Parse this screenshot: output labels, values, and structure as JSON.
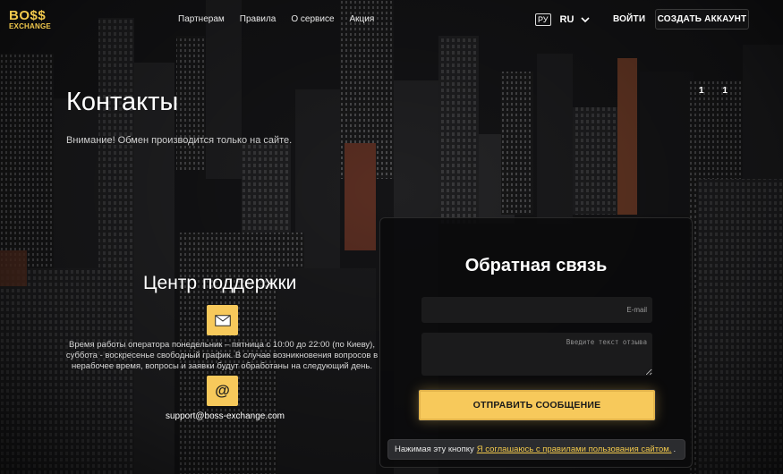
{
  "header": {
    "logo_line1": "BO$$",
    "logo_line2": "EXCHANGE",
    "nav": [
      "Партнерам",
      "Правила",
      "О сервисе",
      "Акция"
    ],
    "lang_flag": "РУ",
    "lang_code": "RU",
    "login": "ВОЙТИ",
    "signup": "СОЗДАТЬ АККАУНТ"
  },
  "page": {
    "title": "Контакты",
    "notice": "Внимание! Обмен производится только на сайте.",
    "corner_numbers": "1 1"
  },
  "support": {
    "title": "Центр поддержки",
    "hours": "Время работы оператора понедельник – пятница с 10:00 до 22:00 (по Киеву), суббота - воскресенье свободный график. В случае возникновения вопросов в нерабочее время, вопросы и заявки будут обработаны на следующий день.",
    "email": "support@boss-exchange.com",
    "icons": [
      "envelope-icon",
      "at-sign-icon"
    ]
  },
  "feedback": {
    "title": "Обратная связь",
    "email_placeholder": "E-mail",
    "message_placeholder": "Введите текст отзыва",
    "send_button": "ОТПРАВИТЬ СООБЩЕНИЕ",
    "consent_prefix": "Нажимая эту кнопку",
    "consent_link": "Я соглашаюсь с правилами пользования сайтом.",
    "consent_suffix": "."
  },
  "colors": {
    "accent": "#f7c95b",
    "brand": "#f2c94c",
    "panel_bg": "#0a0a0b"
  }
}
